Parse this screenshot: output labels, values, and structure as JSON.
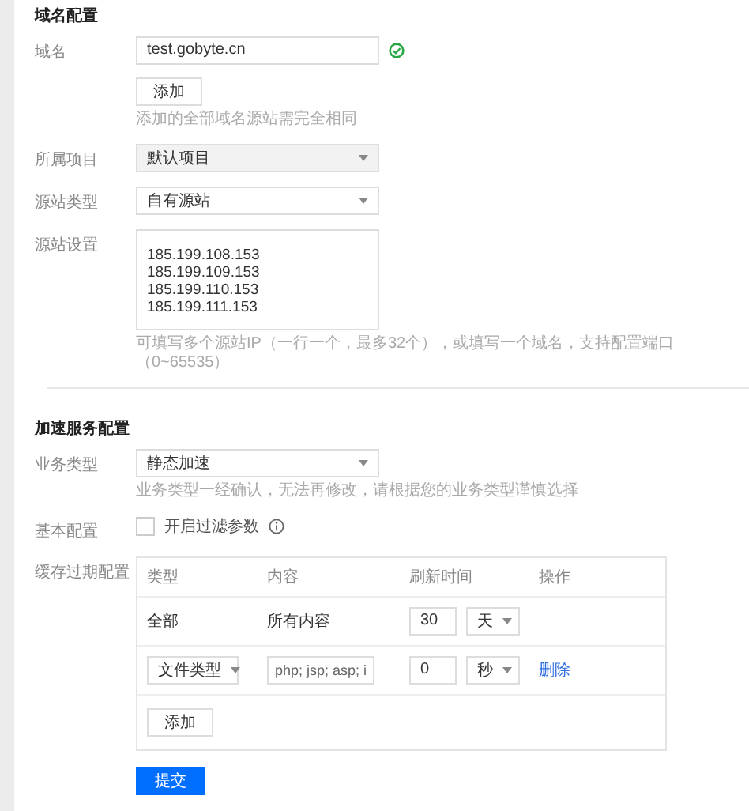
{
  "domain_section": {
    "title": "域名配置",
    "domain": {
      "label": "域名",
      "value": "test.gobyte.cn",
      "valid": true
    },
    "add_button": "添加",
    "add_hint": "添加的全部域名源站需完全相同",
    "project": {
      "label": "所属项目",
      "value": "默认项目",
      "disabled": true
    },
    "origin_type": {
      "label": "源站类型",
      "value": "自有源站",
      "disabled": false
    },
    "origin_settings": {
      "label": "源站设置",
      "lines": [
        "185.199.108.153",
        "185.199.109.153",
        "185.199.110.153",
        "185.199.111.153"
      ],
      "hint": "可填写多个源站IP（一行一个，最多32个），或填写一个域名，支持配置端口（0~65535）"
    }
  },
  "acceleration_section": {
    "title": "加速服务配置",
    "business_type": {
      "label": "业务类型",
      "value": "静态加速",
      "hint": "业务类型一经确认，无法再修改，请根据您的业务类型谨慎选择"
    },
    "basic": {
      "label": "基本配置",
      "option": "开启过滤参数",
      "checked": false
    },
    "cache": {
      "label": "缓存过期配置",
      "columns": [
        "类型",
        "内容",
        "刷新时间",
        "操作"
      ],
      "rows": [
        {
          "kind": "fixed",
          "type": "全部",
          "content": "所有内容",
          "time": "30",
          "unit": "天"
        },
        {
          "kind": "editable",
          "type": "文件类型",
          "content": "php; jsp; asp; i",
          "time": "0",
          "unit": "秒",
          "action": "删除"
        }
      ],
      "add_button": "添加"
    }
  },
  "submit_button": "提交"
}
